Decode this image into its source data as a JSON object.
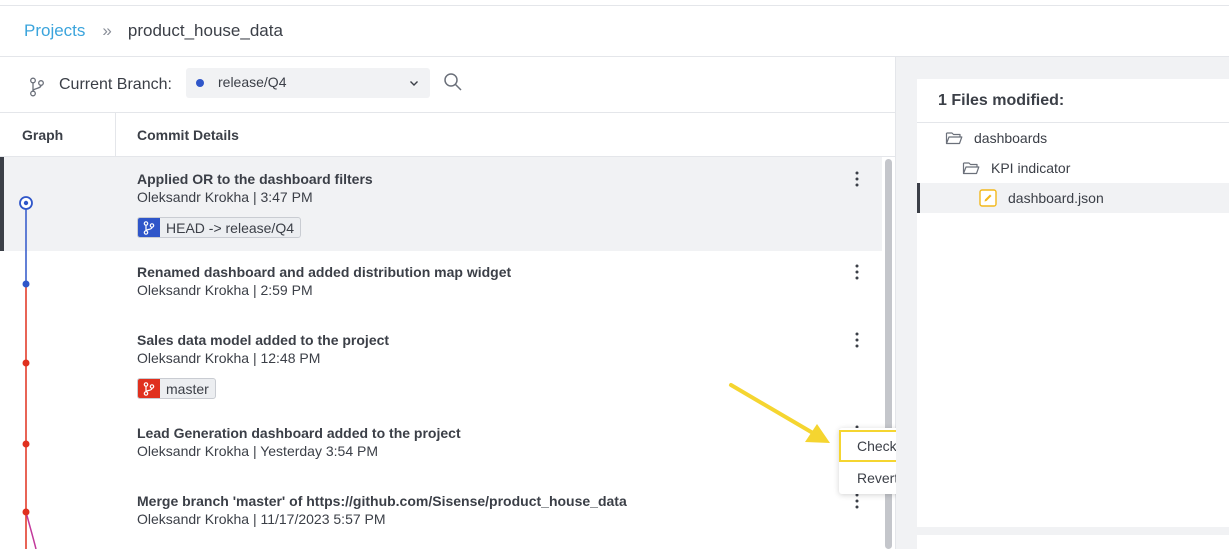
{
  "breadcrumb": {
    "root": "Projects",
    "separator": "»",
    "current": "product_house_data"
  },
  "branch_bar": {
    "label": "Current Branch:",
    "selected_branch": "release/Q4",
    "branch_color": "#2f56c9"
  },
  "columns": {
    "graph": "Graph",
    "details": "Commit Details"
  },
  "commits": [
    {
      "title": "Applied OR to the dashboard filters",
      "meta": "Oleksandr Krokha | 3:47 PM",
      "tag": "HEAD -> release/Q4",
      "tag_color": "#2f56c9",
      "selected": true
    },
    {
      "title": "Renamed dashboard and added distribution map widget",
      "meta": "Oleksandr Krokha | 2:59 PM"
    },
    {
      "title": "Sales data model added to the project",
      "meta": "Oleksandr Krokha | 12:48 PM",
      "tag": "master",
      "tag_color": "#e0301e"
    },
    {
      "title": "Lead Generation dashboard added to the project",
      "meta": "Oleksandr Krokha | Yesterday 3:54 PM"
    },
    {
      "title": "Merge branch 'master' of https://github.com/Sisense/product_house_data",
      "meta": "Oleksandr Krokha | 11/17/2023 5:57 PM"
    }
  ],
  "context_menu": {
    "items": [
      "Checkout",
      "Revert"
    ],
    "highlight_color": "#f5d530"
  },
  "files_panel": {
    "heading": "1 Files modified:",
    "tree": [
      {
        "name": "dashboards",
        "icon": "folder-open-icon"
      },
      {
        "name": "KPI indicator",
        "icon": "folder-open-icon"
      },
      {
        "name": "dashboard.json",
        "icon": "edit-file-icon",
        "selected": true
      }
    ]
  },
  "colors": {
    "link": "#3ba4dc",
    "graph_blue": "#2f56c9",
    "graph_red": "#e0301e",
    "graph_magenta": "#c2399b",
    "annotation": "#f5d530"
  }
}
